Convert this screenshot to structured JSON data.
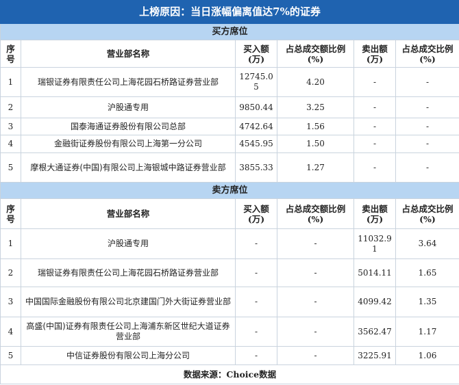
{
  "title": "上榜原因：当日涨幅偏离值达7%的证券",
  "headers": [
    "序号",
    "营业部名称",
    "买入额(万)",
    "占总成交额比例(%)",
    "卖出额(万)",
    "占总成交比例(%)"
  ],
  "buy": {
    "label": "买方席位",
    "rows": [
      [
        "1",
        "瑞银证券有限责任公司上海花园石桥路证券营业部",
        "12745.05",
        "4.20",
        "-",
        "-"
      ],
      [
        "2",
        "沪股通专用",
        "9850.44",
        "3.25",
        "-",
        "-"
      ],
      [
        "3",
        "国泰海通证券股份有限公司总部",
        "4742.64",
        "1.56",
        "-",
        "-"
      ],
      [
        "4",
        "金融街证券股份有限公司上海第一分公司",
        "4545.95",
        "1.50",
        "-",
        "-"
      ],
      [
        "5",
        "摩根大通证券(中国)有限公司上海银城中路证券营业部",
        "3855.33",
        "1.27",
        "-",
        "-"
      ]
    ]
  },
  "sell": {
    "label": "卖方席位",
    "rows": [
      [
        "1",
        "沪股通专用",
        "-",
        "-",
        "11032.91",
        "3.64"
      ],
      [
        "2",
        "瑞银证券有限责任公司上海花园石桥路证券营业部",
        "-",
        "-",
        "5014.11",
        "1.65"
      ],
      [
        "3",
        "中国国际金融股份有限公司北京建国门外大街证券营业部",
        "-",
        "-",
        "4099.42",
        "1.35"
      ],
      [
        "4",
        "高盛(中国)证券有限责任公司上海浦东新区世纪大道证券营业部",
        "-",
        "-",
        "3562.47",
        "1.17"
      ],
      [
        "5",
        "中信证券股份有限公司上海分公司",
        "-",
        "-",
        "3225.91",
        "1.06"
      ]
    ]
  },
  "footer": "数据来源：Choice数据"
}
